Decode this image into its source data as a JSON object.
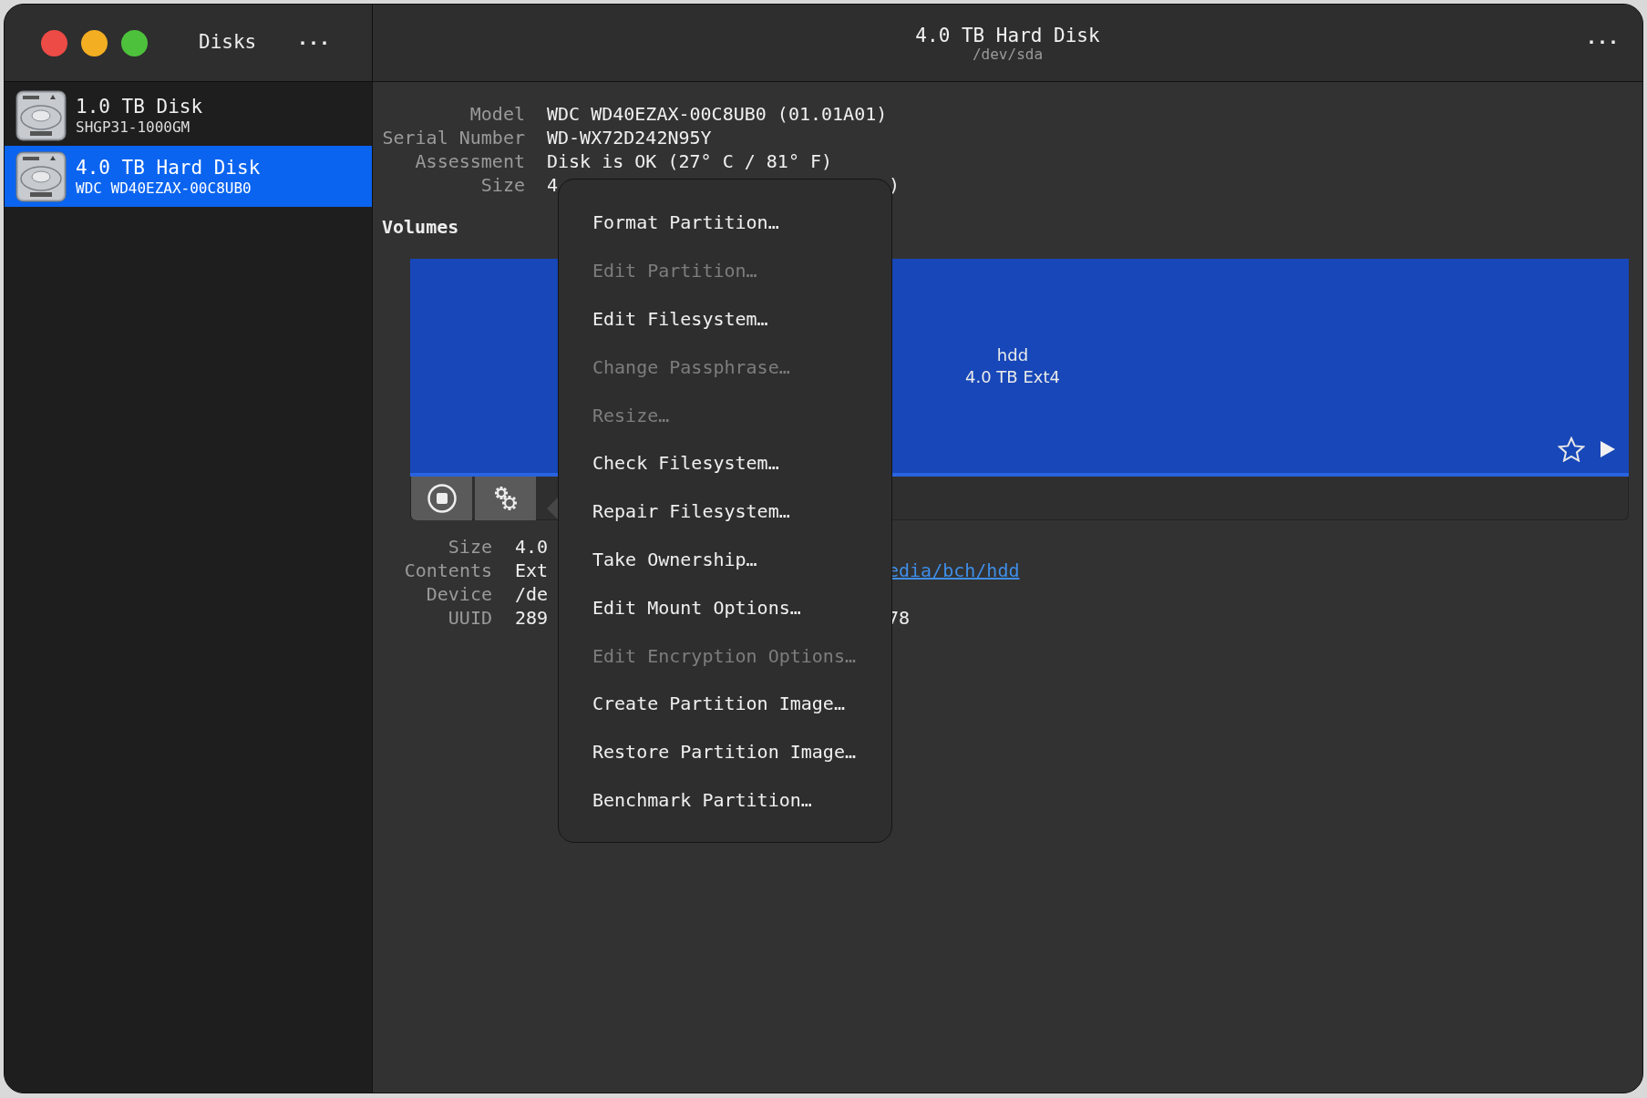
{
  "sidebar": {
    "title": "Disks",
    "menu_glyph": "···",
    "items": [
      {
        "name": "1.0 TB Disk",
        "model": "SHGP31-1000GM",
        "selected": false
      },
      {
        "name": "4.0 TB Hard Disk",
        "model": "WDC WD40EZAX-00C8UB0",
        "selected": true
      }
    ]
  },
  "header": {
    "title": "4.0 TB Hard Disk",
    "subtitle": "/dev/sda",
    "menu_glyph": "···"
  },
  "disk_info": [
    {
      "label": "Model",
      "value": "WDC WD40EZAX-00C8UB0 (01.01A01)"
    },
    {
      "label": "Serial Number",
      "value": "WD-WX72D242N95Y"
    },
    {
      "label": "Assessment",
      "value": "Disk is OK (27° C / 81° F)"
    },
    {
      "label": "Size",
      "value": "4",
      "value_after_menu": ")"
    }
  ],
  "volumes": {
    "heading": "Volumes",
    "partition": {
      "name": "hdd",
      "description": "4.0 TB Ext4"
    }
  },
  "volume_info": [
    {
      "label": "Size",
      "value": "4.0"
    },
    {
      "label": "Contents",
      "value": "Ext",
      "link_after_menu": "edia/bch/hdd"
    },
    {
      "label": "Device",
      "value": "/de"
    },
    {
      "label": "UUID",
      "value": "289",
      "value_after_menu": "78"
    }
  ],
  "menu": [
    {
      "label": "Format Partition…",
      "disabled": false
    },
    {
      "label": "Edit Partition…",
      "disabled": true
    },
    {
      "label": "Edit Filesystem…",
      "disabled": false
    },
    {
      "label": "Change Passphrase…",
      "disabled": true
    },
    {
      "label": "Resize…",
      "disabled": true
    },
    {
      "label": "Check Filesystem…",
      "disabled": false
    },
    {
      "label": "Repair Filesystem…",
      "disabled": false
    },
    {
      "label": "Take Ownership…",
      "disabled": false
    },
    {
      "label": "Edit Mount Options…",
      "disabled": false
    },
    {
      "label": "Edit Encryption Options…",
      "disabled": true
    },
    {
      "label": "Create Partition Image…",
      "disabled": false
    },
    {
      "label": "Restore Partition Image…",
      "disabled": false
    },
    {
      "label": "Benchmark Partition…",
      "disabled": false
    }
  ]
}
